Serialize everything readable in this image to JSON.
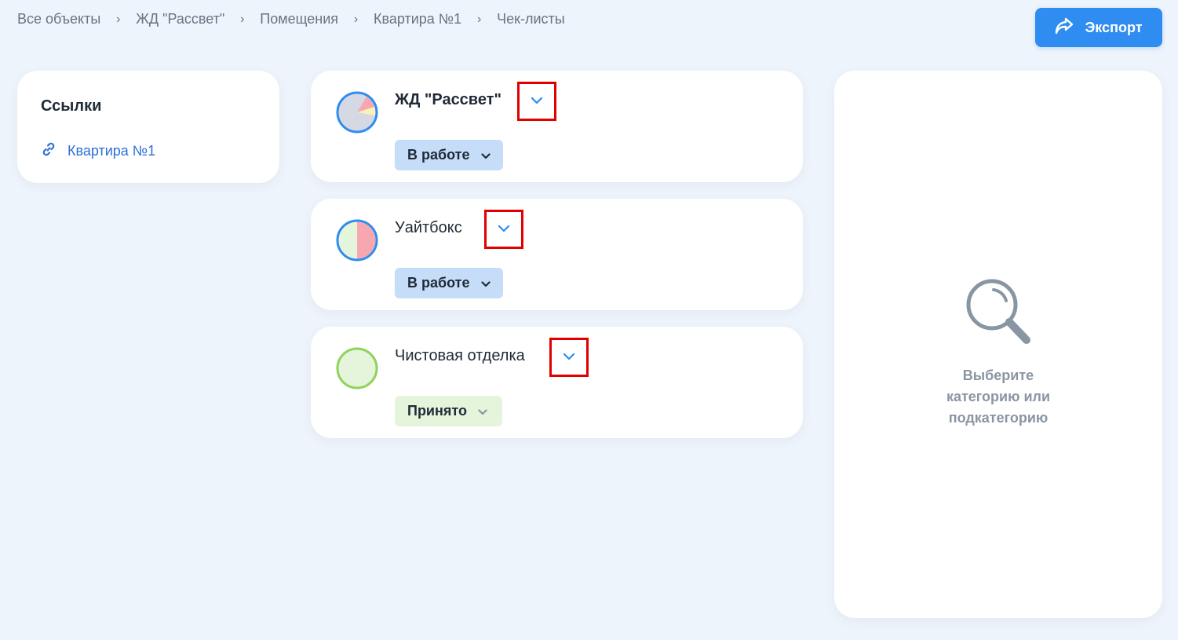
{
  "breadcrumb": {
    "items": [
      "Все объекты",
      "ЖД \"Рассвет\"",
      "Помещения",
      "Квартира №1",
      "Чек-листы"
    ]
  },
  "toolbar": {
    "export_label": "Экспорт",
    "export_icon": "share-arrow-icon"
  },
  "links": {
    "title": "Ссылки",
    "items": [
      {
        "label": "Квартира №1",
        "icon": "link-icon"
      }
    ]
  },
  "checklists": [
    {
      "title": "ЖД \"Рассвет\"",
      "status": "В работе",
      "status_color": "#c5ddf8"
    },
    {
      "title": "Уайтбокс",
      "status": "В работе",
      "status_color": "#c5ddf8"
    },
    {
      "title": "Чистовая отделка",
      "status": "Принято",
      "status_color": "#e4f5dc"
    }
  ],
  "detail": {
    "empty_icon": "search-icon",
    "empty_lines": [
      "Выберите",
      "категорию или",
      "подкатегорию"
    ]
  },
  "colors": {
    "accent": "#2f8cf0",
    "background": "#eef4fb",
    "highlight_box": "#e00000"
  }
}
